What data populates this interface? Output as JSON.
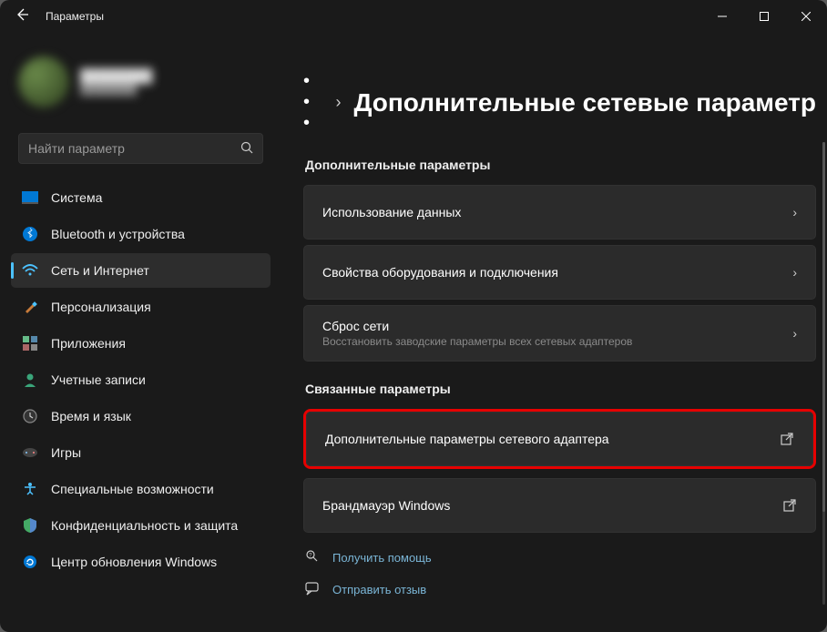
{
  "window": {
    "title": "Параметры"
  },
  "profile": {
    "name": "████████",
    "email": "████████"
  },
  "search": {
    "placeholder": "Найти параметр"
  },
  "nav": {
    "items": [
      {
        "label": "Система"
      },
      {
        "label": "Bluetooth и устройства"
      },
      {
        "label": "Сеть и Интернет"
      },
      {
        "label": "Персонализация"
      },
      {
        "label": "Приложения"
      },
      {
        "label": "Учетные записи"
      },
      {
        "label": "Время и язык"
      },
      {
        "label": "Игры"
      },
      {
        "label": "Специальные возможности"
      },
      {
        "label": "Конфиденциальность и защита"
      },
      {
        "label": "Центр обновления Windows"
      }
    ]
  },
  "breadcrumb": {
    "dots": "• • •",
    "sep": "›",
    "title": "Дополнительные сетевые параметр"
  },
  "section1": {
    "head": "Дополнительные параметры",
    "cards": [
      {
        "title": "Использование данных"
      },
      {
        "title": "Свойства оборудования и подключения"
      },
      {
        "title": "Сброс сети",
        "sub": "Восстановить заводские параметры всех сетевых адаптеров"
      }
    ]
  },
  "section2": {
    "head": "Связанные параметры",
    "cards": [
      {
        "title": "Дополнительные параметры сетевого адаптера"
      },
      {
        "title": "Брандмауэр Windows"
      }
    ]
  },
  "links": {
    "help": "Получить помощь",
    "feedback": "Отправить отзыв"
  }
}
